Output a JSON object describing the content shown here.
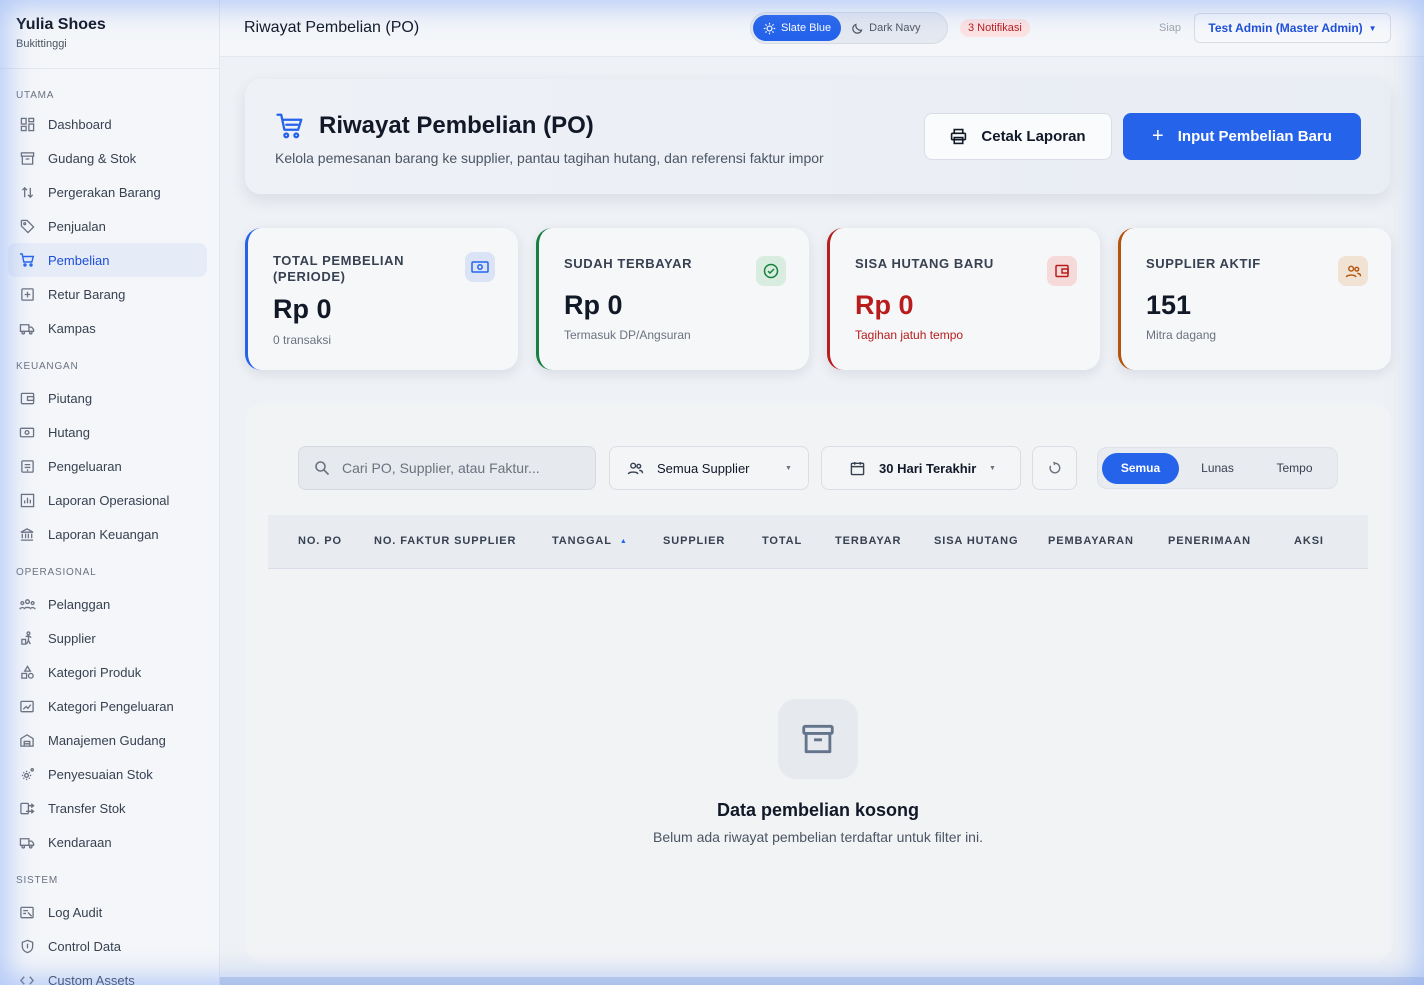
{
  "brand": {
    "name": "Yulia Shoes",
    "city": "Bukittinggi"
  },
  "sidebar": {
    "sections": [
      {
        "title": "UTAMA",
        "items": [
          "Dashboard",
          "Gudang & Stok",
          "Pergerakan Barang",
          "Penjualan",
          "Pembelian",
          "Retur Barang",
          "Kampas"
        ]
      },
      {
        "title": "KEUANGAN",
        "items": [
          "Piutang",
          "Hutang",
          "Pengeluaran",
          "Laporan Operasional",
          "Laporan Keuangan"
        ]
      },
      {
        "title": "OPERASIONAL",
        "items": [
          "Pelanggan",
          "Supplier",
          "Kategori Produk",
          "Kategori Pengeluaran",
          "Manajemen Gudang",
          "Penyesuaian Stok",
          "Transfer Stok",
          "Kendaraan"
        ]
      },
      {
        "title": "SISTEM",
        "items": [
          "Log Audit",
          "Control Data",
          "Custom Assets"
        ]
      }
    ],
    "active": "Pembelian"
  },
  "topbar": {
    "title": "Riwayat Pembelian (PO)",
    "theme_light": "Slate Blue",
    "theme_dark": "Dark Navy",
    "notifications": "3 Notifikasi",
    "status": "Siap",
    "user": "Test Admin (Master Admin)"
  },
  "header": {
    "title": "Riwayat Pembelian (PO)",
    "subtitle": "Kelola pemesanan barang ke supplier, pantau tagihan hutang, dan referensi faktur impor",
    "print_label": "Cetak Laporan",
    "new_label": "Input Pembelian Baru"
  },
  "stats": [
    {
      "label": "TOTAL PEMBELIAN (PERIODE)",
      "value": "Rp 0",
      "note": "0 transaksi",
      "color": "#2563eb"
    },
    {
      "label": "SUDAH TERBAYAR",
      "value": "Rp 0",
      "note": "Termasuk DP/Angsuran",
      "color": "#15803d"
    },
    {
      "label": "SISA HUTANG BARU",
      "value": "Rp 0",
      "note": "Tagihan jatuh tempo",
      "color": "#b91c1c"
    },
    {
      "label": "SUPPLIER AKTIF",
      "value": "151",
      "note": "Mitra dagang",
      "color": "#b45309"
    }
  ],
  "filters": {
    "search_placeholder": "Cari PO, Supplier, atau Faktur...",
    "supplier": "Semua Supplier",
    "period": "30 Hari Terakhir",
    "segments": [
      "Semua",
      "Lunas",
      "Tempo"
    ],
    "active_segment": "Semua"
  },
  "table": {
    "columns": [
      "NO. PO",
      "NO. FAKTUR SUPPLIER",
      "TANGGAL",
      "SUPPLIER",
      "TOTAL",
      "TERBAYAR",
      "SISA HUTANG",
      "PEMBAYARAN",
      "PENERIMAAN",
      "AKSI"
    ],
    "rows": []
  },
  "empty": {
    "title": "Data pembelian kosong",
    "subtitle": "Belum ada riwayat pembelian terdaftar untuk filter ini."
  }
}
